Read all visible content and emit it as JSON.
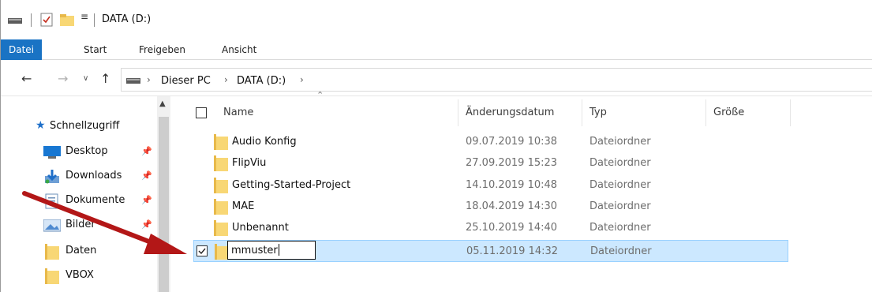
{
  "window": {
    "title": "DATA (D:)"
  },
  "ribbon": {
    "tabs": [
      {
        "label": "Datei"
      },
      {
        "label": "Start"
      },
      {
        "label": "Freigeben"
      },
      {
        "label": "Ansicht"
      }
    ]
  },
  "address": {
    "crumbs": [
      "Dieser PC",
      "DATA (D:)"
    ]
  },
  "nav": {
    "quick_access": "Schnellzugriff",
    "items": [
      {
        "label": "Desktop",
        "pinned": true,
        "icon": "desktop-icon"
      },
      {
        "label": "Downloads",
        "pinned": true,
        "icon": "downloads-icon"
      },
      {
        "label": "Dokumente",
        "pinned": true,
        "icon": "documents-icon"
      },
      {
        "label": "Bilder",
        "pinned": true,
        "icon": "pictures-icon"
      },
      {
        "label": "Daten",
        "pinned": false,
        "icon": "folder-icon"
      },
      {
        "label": "VBOX",
        "pinned": false,
        "icon": "folder-icon"
      }
    ]
  },
  "list": {
    "columns": {
      "name": "Name",
      "date": "Änderungsdatum",
      "type": "Typ",
      "size": "Größe"
    },
    "rows": [
      {
        "name": "Audio Konfig",
        "date": "09.07.2019 10:38",
        "type": "Dateiordner"
      },
      {
        "name": "FlipViu",
        "date": "27.09.2019 15:23",
        "type": "Dateiordner"
      },
      {
        "name": "Getting-Started-Project",
        "date": "14.10.2019 10:48",
        "type": "Dateiordner"
      },
      {
        "name": "MAE",
        "date": "18.04.2019 14:30",
        "type": "Dateiordner"
      },
      {
        "name": "Unbenannt",
        "date": "25.10.2019 14:40",
        "type": "Dateiordner"
      }
    ],
    "editing_row": {
      "name": "mmuster",
      "date": "05.11.2019 14:32",
      "type": "Dateiordner",
      "checked": true
    }
  },
  "colors": {
    "accent": "#1a73c4",
    "selection": "#cce8ff",
    "annotation_arrow": "#b31717",
    "folder": "#f8d775"
  }
}
